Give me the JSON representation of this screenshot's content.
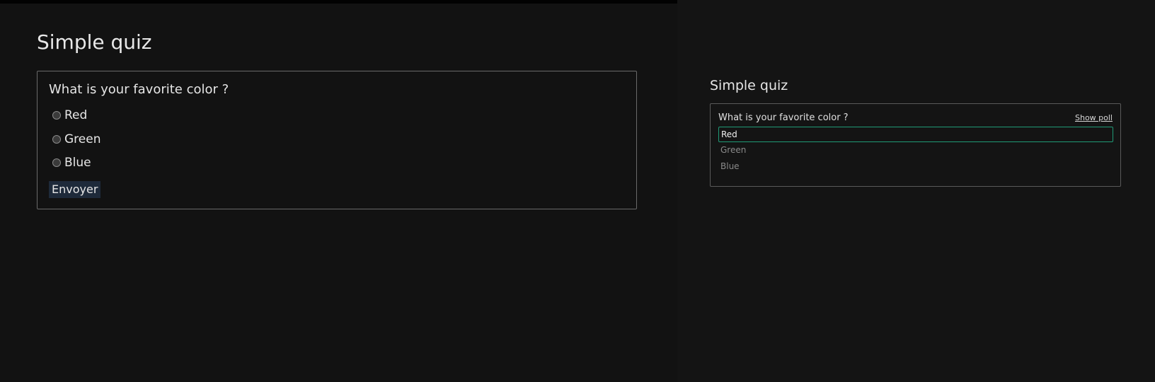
{
  "quiz": {
    "title": "Simple quiz",
    "question": "What is your favorite color ?",
    "options": [
      "Red",
      "Green",
      "Blue"
    ],
    "submit_label": "Envoyer"
  },
  "poll": {
    "title": "Simple quiz",
    "question": "What is your favorite color ?",
    "show_poll_label": "Show poll",
    "options": [
      "Red",
      "Green",
      "Blue"
    ],
    "selected": "Red",
    "selected_border_color": "#1f9a76"
  }
}
